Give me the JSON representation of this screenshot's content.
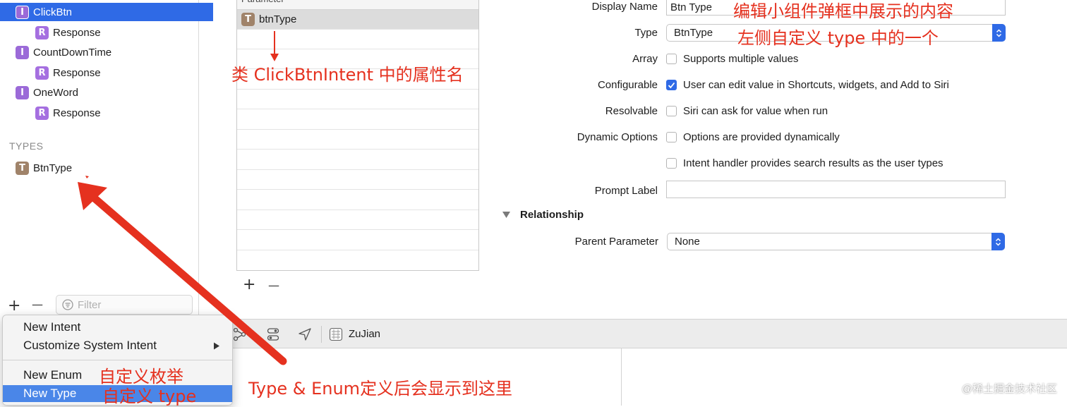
{
  "navigator": {
    "items": [
      {
        "badge": "I",
        "label": "ClickBtn",
        "selected": true
      },
      {
        "badge": "R",
        "label": "Response"
      },
      {
        "badge": "I",
        "label": "CountDownTime"
      },
      {
        "badge": "R",
        "label": "Response"
      },
      {
        "badge": "I",
        "label": "OneWord"
      },
      {
        "badge": "R",
        "label": "Response"
      }
    ],
    "types_header": "TYPES",
    "types": [
      {
        "badge": "T",
        "label": "BtnType"
      }
    ],
    "filter_placeholder": "Filter",
    "add_symbol": "+",
    "remove_symbol": "—"
  },
  "parameters": {
    "header": "Parameter",
    "rows": [
      {
        "badge": "T",
        "label": "btnType"
      }
    ],
    "add_symbol": "+",
    "remove_symbol": "—"
  },
  "inspector": {
    "display_name": {
      "label": "Display Name",
      "value": "Btn Type"
    },
    "type": {
      "label": "Type",
      "value": "BtnType"
    },
    "array": {
      "label": "Array",
      "option": "Supports multiple values",
      "checked": false
    },
    "configurable": {
      "label": "Configurable",
      "option": "User can edit value in Shortcuts, widgets, and Add to Siri",
      "checked": true
    },
    "resolvable": {
      "label": "Resolvable",
      "option": "Siri can ask for value when run",
      "checked": false
    },
    "dynamic_options": {
      "label": "Dynamic Options",
      "option": "Options are provided dynamically",
      "checked": false
    },
    "search_option": {
      "option": "Intent handler provides search results as the user types",
      "checked": false
    },
    "prompt_label": {
      "label": "Prompt Label",
      "value": ""
    },
    "relationship": {
      "title": "Relationship",
      "parent_label": "Parent Parameter",
      "parent_value": "None"
    }
  },
  "editor_bar": {
    "scheme": "ZuJian"
  },
  "context_menu": {
    "items": [
      {
        "label": "New Intent"
      },
      {
        "label": "Customize System Intent",
        "has_submenu": true
      },
      {
        "label": "New Enum"
      },
      {
        "label": "New Type",
        "highlighted": true
      }
    ]
  },
  "annotations": {
    "display_name_note": "编辑小组件弹框中展示的内容",
    "type_note": "左侧自定义 type 中的一个",
    "param_note": "类 ClickBtnIntent 中的属性名",
    "enum_note": "自定义枚举",
    "type_menu_note": "自定义 type",
    "result_note": "Type & Enum定义后会显示到这里"
  },
  "watermark": "@稀土掘金技术社区",
  "colors": {
    "accent": "#2f6ae6",
    "annotation": "#e5311f",
    "intent_badge": "#9b6ad8",
    "type_badge": "#a0836a"
  }
}
